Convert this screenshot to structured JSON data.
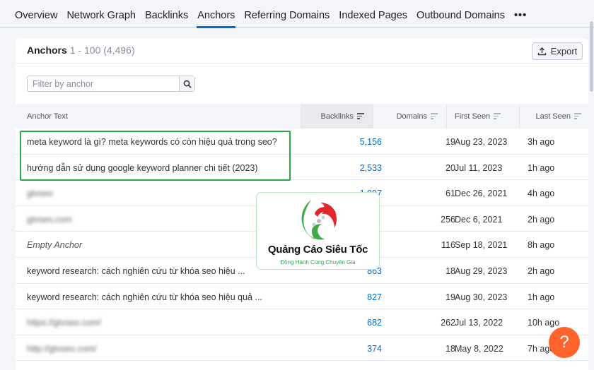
{
  "tabs": [
    {
      "label": "Overview"
    },
    {
      "label": "Network Graph"
    },
    {
      "label": "Backlinks"
    },
    {
      "label": "Anchors",
      "active": true
    },
    {
      "label": "Referring Domains"
    },
    {
      "label": "Indexed Pages"
    },
    {
      "label": "Outbound Domains"
    }
  ],
  "tabs_more": "•••",
  "card": {
    "title": "Anchors",
    "range": "1 - 100 (4,496)",
    "export_label": "Export",
    "filter_placeholder": "Filter by anchor"
  },
  "columns": {
    "anchor": "Anchor Text",
    "backlinks": "Backlinks",
    "domains": "Domains",
    "first_seen": "First Seen",
    "last_seen": "Last Seen"
  },
  "rows": [
    {
      "anchor": "meta keyword là gì? meta keywords có còn hiệu quả trong seo?",
      "backlinks": "5,156",
      "domains": "19",
      "first_seen": "Aug 23, 2023",
      "last_seen": "3h ago"
    },
    {
      "anchor": "hướng dẫn sử dụng google keyword planner chi tiết (2023)",
      "backlinks": "2,533",
      "domains": "20",
      "first_seen": "Jul 11, 2023",
      "last_seen": "1h ago"
    },
    {
      "anchor": "gtvseo",
      "backlinks": "1,097",
      "domains": "61",
      "first_seen": "Dec 26, 2021",
      "last_seen": "4h ago",
      "blur": true
    },
    {
      "anchor": "gtvseo.com",
      "backlinks": "",
      "domains": "256",
      "first_seen": "Dec 6, 2021",
      "last_seen": "2h ago",
      "blur": true
    },
    {
      "anchor": "Empty Anchor",
      "backlinks": "",
      "domains": "116",
      "first_seen": "Sep 18, 2021",
      "last_seen": "8h ago",
      "italic": true
    },
    {
      "anchor": "keyword research: cách nghiên cứu từ khóa seo hiệu ...",
      "backlinks": "863",
      "domains": "18",
      "first_seen": "Aug 29, 2023",
      "last_seen": "2h ago"
    },
    {
      "anchor": "keyword research: cách nghiên cứu từ khóa seo hiệu quả ...",
      "backlinks": "827",
      "domains": "19",
      "first_seen": "Aug 30, 2023",
      "last_seen": "1h ago"
    },
    {
      "anchor": "https://gtvseo.com/",
      "backlinks": "682",
      "domains": "262",
      "first_seen": "Jul 13, 2022",
      "last_seen": "10h ago",
      "blur": true
    },
    {
      "anchor": "http://gtvseo.com/",
      "backlinks": "374",
      "domains": "18",
      "first_seen": "May 8, 2022",
      "last_seen": "7h ago",
      "blur": true
    }
  ],
  "watermark": {
    "name": "Quảng Cáo Siêu Tốc",
    "slogan": "Đồng Hành Cùng Chuyên Gia"
  },
  "help_label": "?",
  "colors": {
    "accent": "#006dca",
    "highlight_box": "#2aa84a",
    "help": "#ff642d"
  }
}
